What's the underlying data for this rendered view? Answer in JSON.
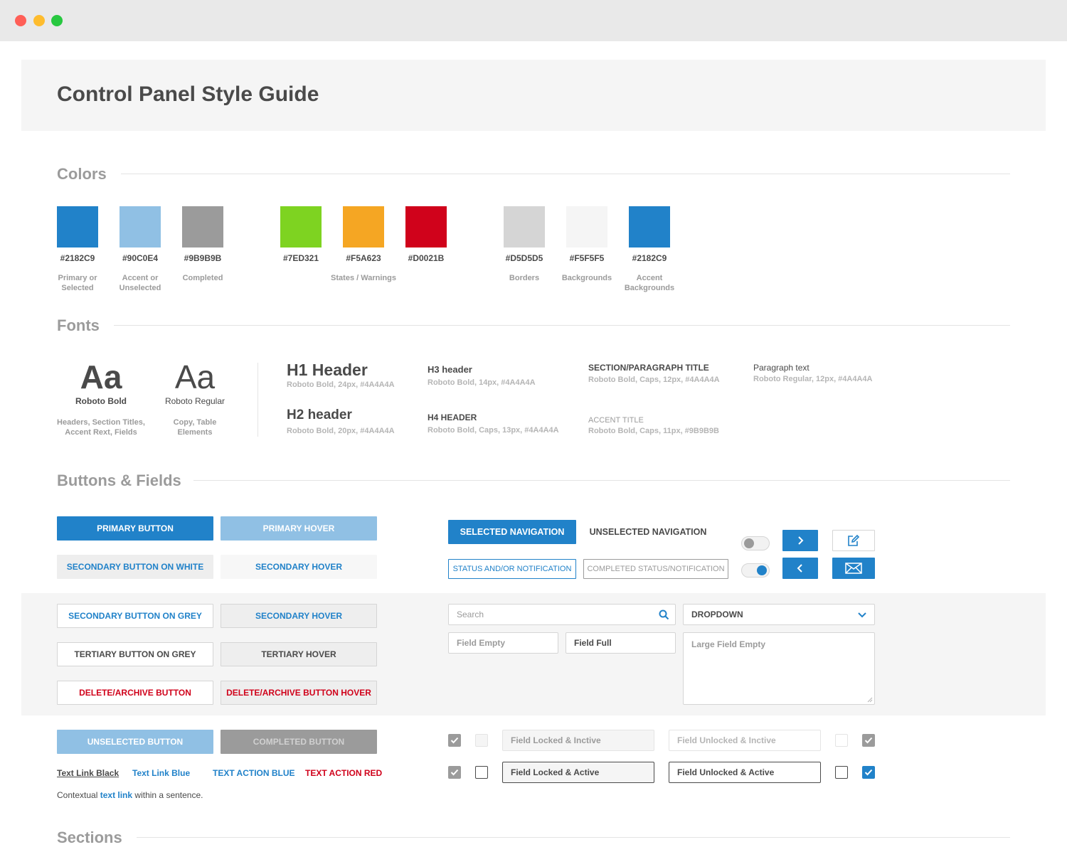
{
  "page": {
    "title": "Control Panel Style Guide"
  },
  "sections": {
    "colors": "Colors",
    "fonts": "Fonts",
    "buttons": "Buttons & Fields",
    "sections": "Sections"
  },
  "colors": [
    {
      "hex": "#2182C9",
      "label1": "Primary or",
      "label2": "Selected"
    },
    {
      "hex": "#90C0E4",
      "label1": "Accent or",
      "label2": "Unselected"
    },
    {
      "hex": "#9B9B9B",
      "label1": "Completed",
      "label2": ""
    },
    {
      "hex": "#7ED321",
      "label1": "",
      "label2": ""
    },
    {
      "hex": "#F5A623",
      "label1": "States / Warnings",
      "label2": ""
    },
    {
      "hex": "#D0021B",
      "label1": "",
      "label2": ""
    },
    {
      "hex": "#D5D5D5",
      "label1": "Borders",
      "label2": ""
    },
    {
      "hex": "#F5F5F5",
      "label1": "Backgrounds",
      "label2": ""
    },
    {
      "hex": "#2182C9",
      "label1": "Accent",
      "label2": "Backgrounds"
    }
  ],
  "fonts": {
    "bold": {
      "sample": "Aa",
      "name": "Roboto Bold",
      "desc1": "Headers, Section Titles,",
      "desc2": "Accent Rext, Fields"
    },
    "regular": {
      "sample": "Aa",
      "name": "Roboto Regular",
      "desc1": "Copy, Table",
      "desc2": "Elements"
    },
    "type": [
      {
        "name": "H1 Header",
        "desc": "Roboto Bold, 24px,  #4A4A4A"
      },
      {
        "name": "H2 header",
        "desc": "Roboto Bold, 20px,  #4A4A4A"
      },
      {
        "name": "H3 header",
        "desc": "Roboto Bold, 14px,  #4A4A4A"
      },
      {
        "name": "H4 HEADER",
        "desc": "Roboto Bold, Caps, 13px,  #4A4A4A"
      },
      {
        "name": "SECTION/PARAGRAPH TITLE",
        "desc": "Roboto Bold, Caps, 12px,  #4A4A4A"
      },
      {
        "name": "ACCENT TITLE",
        "desc": "Roboto Bold, Caps, 11px,  #9B9B9B"
      },
      {
        "name": "Paragraph text",
        "desc": "Roboto Regular, 12px,  #4A4A4A"
      }
    ]
  },
  "buttons": {
    "primary": "PRIMARY BUTTON",
    "primary_hover": "PRIMARY HOVER",
    "secondary_white": "SECONDARY BUTTON ON WHITE",
    "secondary_hover": "SECONDARY HOVER",
    "secondary_grey": "SECONDARY BUTTON ON GREY",
    "secondary_grey_hover": "SECONDARY HOVER",
    "tertiary_grey": "TERTIARY BUTTON ON GREY",
    "tertiary_hover": "TERTIARY HOVER",
    "delete": "DELETE/ARCHIVE BUTTON",
    "delete_hover": "DELETE/ARCHIVE BUTTON HOVER",
    "unselected": "UNSELECTED BUTTON",
    "completed": "COMPLETED BUTTON"
  },
  "nav": {
    "selected": "SELECTED NAVIGATION",
    "unselected": "UNSELECTED NAVIGATION",
    "status": "STATUS AND/OR NOTIFICATION",
    "completed_status": "COMPLETED STATUS/NOTIFICATION"
  },
  "links": {
    "black": "Text Link Black",
    "blue": "Text Link Blue",
    "action_blue": "TEXT ACTION BLUE",
    "action_red": "TEXT ACTION RED",
    "contextual_before": "Contextual",
    "contextual_link": "text link",
    "contextual_after": "within a sentence."
  },
  "fields": {
    "search_placeholder": "Search",
    "dropdown": "DROPDOWN",
    "empty": "Field Empty",
    "full": "Field Full",
    "large_empty": "Large Field Empty",
    "locked_inactive": "Field Locked & Inctive",
    "unlocked_inactive": "Field Unlocked & Inctive",
    "locked_active": "Field Locked & Active",
    "unlocked_active": "Field Unlocked & Active"
  },
  "theme": {
    "primary": "#2182C9",
    "accent": "#90C0E4",
    "completed": "#9B9B9B",
    "danger": "#D0021B",
    "border": "#D5D5D5",
    "background": "#F5F5F5",
    "text": "#4A4A4A"
  },
  "icons": [
    "chevron-right-icon",
    "chevron-left-icon",
    "edit-icon",
    "mail-icon",
    "search-icon",
    "chevron-down-icon",
    "check-icon"
  ]
}
